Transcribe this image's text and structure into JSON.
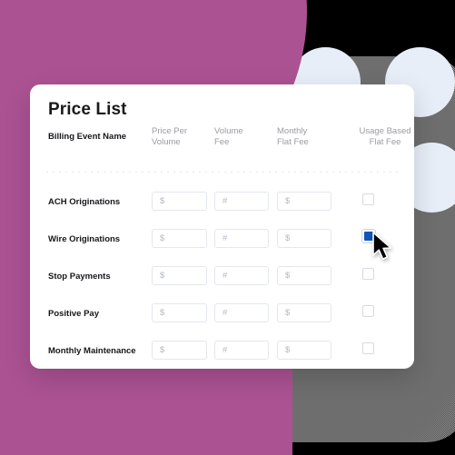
{
  "card": {
    "title": "Price List",
    "columns": [
      {
        "label": "Billing Event Name",
        "align": "left",
        "emphasis": true
      },
      {
        "label": "Price Per\nVolume",
        "align": "left",
        "emphasis": false
      },
      {
        "label": "Volume\nFee",
        "align": "left",
        "emphasis": false
      },
      {
        "label": "Monthly\nFlat Fee",
        "align": "left",
        "emphasis": false
      },
      {
        "label": "Usage Based\nFlat Fee",
        "align": "center",
        "emphasis": false
      }
    ],
    "placeholders": {
      "price_per_volume": "$",
      "volume_fee": "#",
      "monthly_flat_fee": "$"
    },
    "rows": [
      {
        "name": "ACH Originations",
        "price_per_volume": "",
        "volume_fee": "",
        "monthly_flat_fee": "",
        "usage_based_flat_fee": false
      },
      {
        "name": "Wire Originations",
        "price_per_volume": "",
        "volume_fee": "",
        "monthly_flat_fee": "",
        "usage_based_flat_fee": true
      },
      {
        "name": "Stop Payments",
        "price_per_volume": "",
        "volume_fee": "",
        "monthly_flat_fee": "",
        "usage_based_flat_fee": false
      },
      {
        "name": "Positive Pay",
        "price_per_volume": "",
        "volume_fee": "",
        "monthly_flat_fee": "",
        "usage_based_flat_fee": false
      },
      {
        "name": "Monthly Maintenance",
        "price_per_volume": "",
        "volume_fee": "",
        "monthly_flat_fee": "",
        "usage_based_flat_fee": false
      }
    ]
  },
  "pointer": {
    "icon": "mouse-cursor-arrow"
  },
  "colors": {
    "background": "#000000",
    "magenta_shape": "#ab5293",
    "pale_blue_circle": "#e8eef8",
    "grey_plate": "#6e6e6e",
    "card_surface": "#ffffff",
    "checkbox_checked": "#1056b8",
    "input_border": "#e4e7ef",
    "header_text": "#9b9ba3",
    "label_text": "#17171c"
  }
}
